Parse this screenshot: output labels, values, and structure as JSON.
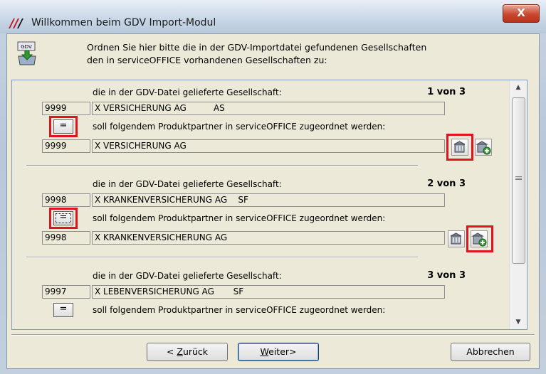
{
  "window": {
    "title": "Willkommen beim GDV Import-Modul",
    "close_label": "X"
  },
  "header": {
    "icon_label": "GDV",
    "line1": "Ordnen Sie hier bitte die in der GDV-Importdatei gefundenen Gesellschaften",
    "line2": "den in serviceOFFICE vorhandenen Gesellschaften zu:"
  },
  "groups": [
    {
      "heading": "die in der GDV-Datei gelieferte Gesellschaft:",
      "counter": "1 von 3",
      "source_code": "9999",
      "source_name": "X VERSICHERUNG AG          AS",
      "eq_label": "=",
      "assign_text": "soll folgendem Produktpartner in serviceOFFICE zugeordnet werden:",
      "target_code": "9999",
      "target_name": "X VERSICHERUNG AG"
    },
    {
      "heading": "die in der GDV-Datei gelieferte Gesellschaft:",
      "counter": "2 von 3",
      "source_code": "9998",
      "source_name": "X KRANKENVERSICHERUNG AG    SF",
      "eq_label": "=",
      "assign_text": "soll folgendem Produktpartner in serviceOFFICE zugeordnet werden:",
      "target_code": "9998",
      "target_name": "X KRANKENVERSICHERUNG AG"
    },
    {
      "heading": "die in der GDV-Datei gelieferte Gesellschaft:",
      "counter": "3 von 3",
      "source_code": "9997",
      "source_name": "X LEBENVERSICHERUNG AG       SF",
      "eq_label": "=",
      "assign_text": "soll folgendem Produktpartner in serviceOFFICE zugeordnet werden:"
    }
  ],
  "footer": {
    "back_prefix": "< ",
    "back_underlined": "Z",
    "back_rest": "urück",
    "next_underlined": "W",
    "next_rest": "eiter>",
    "cancel": "Abbrechen"
  },
  "colors": {
    "highlight": "#e0141e",
    "close_button": "#c9472f"
  }
}
